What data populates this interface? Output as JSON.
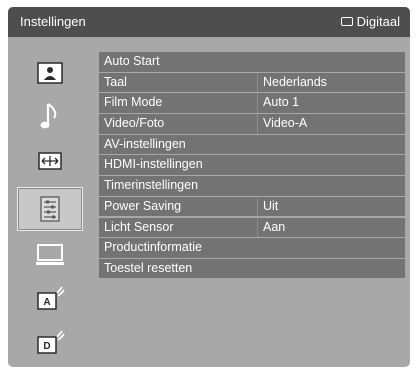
{
  "header": {
    "title": "Instellingen",
    "source_label": "Digitaal",
    "source_icon": "tv-source-icon"
  },
  "sidebar": {
    "items": [
      {
        "icon": "picture-icon"
      },
      {
        "icon": "music-note-icon"
      },
      {
        "icon": "screen-format-icon"
      },
      {
        "icon": "settings-list-icon",
        "selected": true
      },
      {
        "icon": "monitor-icon"
      },
      {
        "icon": "analog-antenna-icon"
      },
      {
        "icon": "digital-antenna-icon"
      }
    ]
  },
  "menu": {
    "rows": [
      {
        "label": "Auto Start",
        "value": ""
      },
      {
        "label": "Taal",
        "value": "Nederlands"
      },
      {
        "label": "Film Mode",
        "value": "Auto 1"
      },
      {
        "label": "Video/Foto",
        "value": "Video-A"
      },
      {
        "label": "AV-instellingen",
        "value": ""
      },
      {
        "label": "HDMI-instellingen",
        "value": ""
      },
      {
        "label": "Timerinstellingen",
        "value": ""
      },
      {
        "label": "Power Saving",
        "value": "Uit"
      },
      {
        "label": "Licht Sensor",
        "value": "Aan"
      },
      {
        "label": "Productinformatie",
        "value": ""
      },
      {
        "label": "Toestel resetten",
        "value": ""
      }
    ]
  },
  "colors": {
    "header_bg": "#4e4e4e",
    "screen_bg": "#a8a8a8",
    "row_bg": "#737373",
    "text": "#ffffff"
  }
}
